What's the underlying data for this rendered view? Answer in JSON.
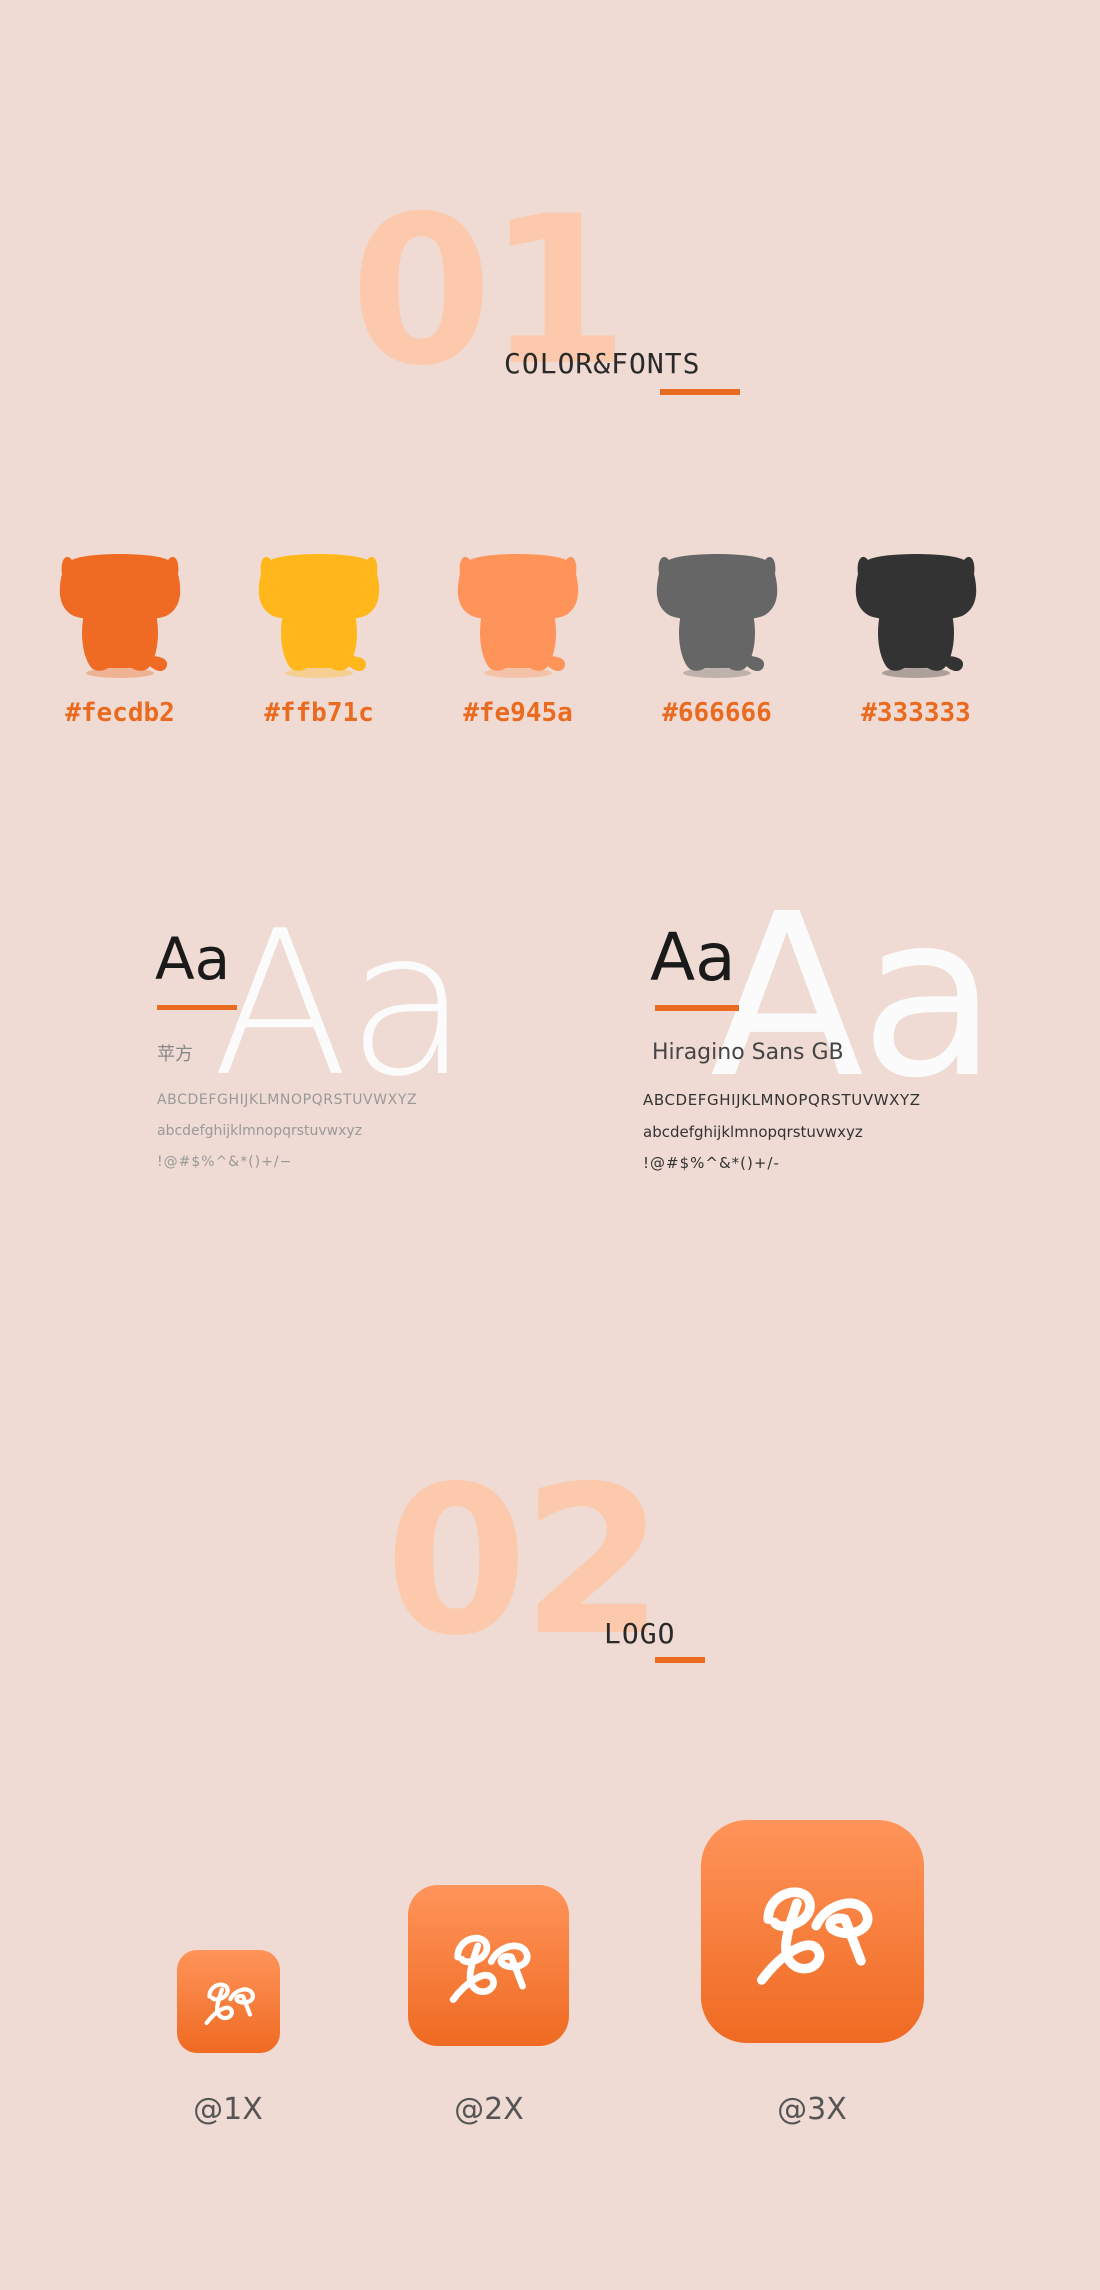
{
  "section1": {
    "number": "01",
    "title": "COLOR&FONTS"
  },
  "colors": [
    {
      "fill": "#ef6a22",
      "label": "#fecdb2"
    },
    {
      "fill": "#ffb71c",
      "label": "#ffb71c"
    },
    {
      "fill": "#fe945a",
      "label": "#fe945a"
    },
    {
      "fill": "#666666",
      "label": "#666666"
    },
    {
      "fill": "#333333",
      "label": "#333333"
    }
  ],
  "fonts": [
    {
      "sample": "Aa",
      "name": "苹方",
      "upper": "ABCDEFGHIJKLMNOPQRSTUVWXYZ",
      "lower": "abcdefghijklmnopqrstuvwxyz",
      "symbols": "!@#$%^&*()+/−"
    },
    {
      "sample": "Aa",
      "name": "Hiragino Sans GB",
      "upper": "ABCDEFGHIJKLMNOPQRSTUVWXYZ",
      "lower": "abcdefghijklmnopqrstuvwxyz",
      "symbols": "!@#$%^&*()+/-"
    }
  ],
  "section2": {
    "number": "02",
    "title": "LOGO"
  },
  "logos": [
    {
      "label": "@1X"
    },
    {
      "label": "@2X"
    },
    {
      "label": "@3X"
    }
  ]
}
